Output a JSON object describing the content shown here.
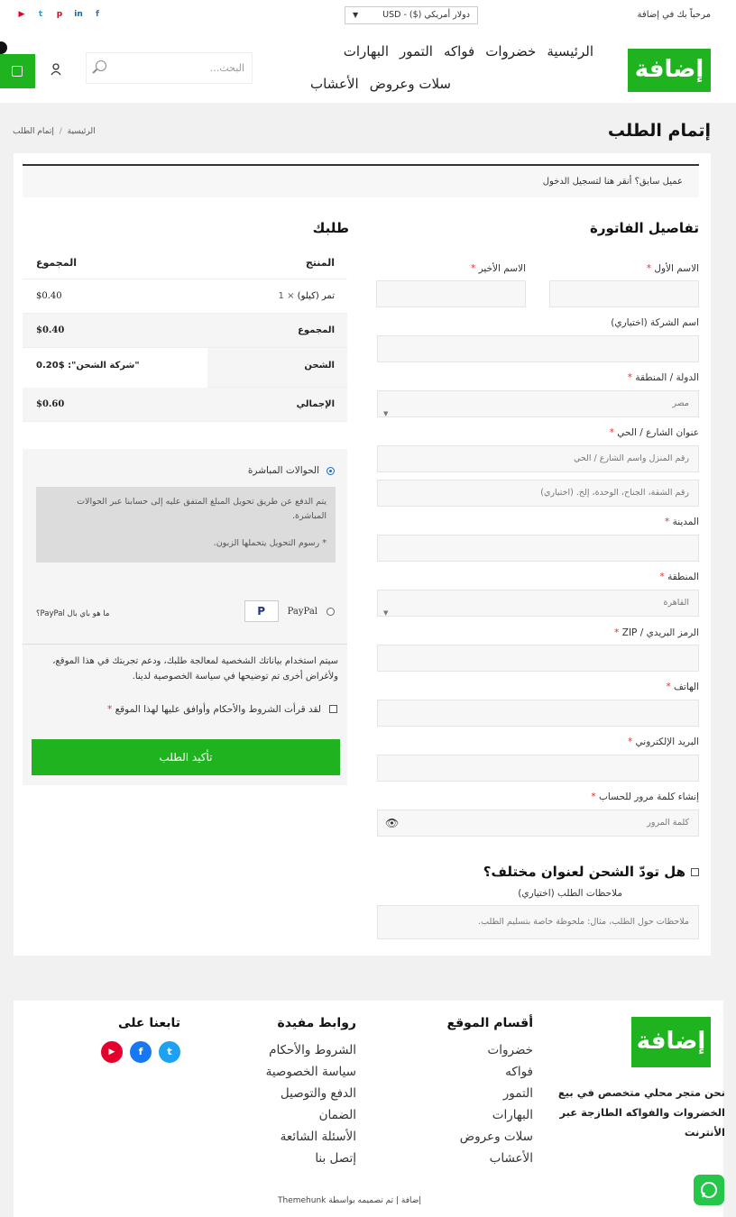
{
  "topbar": {
    "welcome": "مرحباً بك في إضافة",
    "currency": "دولار أمريكي ($) - USD",
    "currency_arrow": "▼",
    "social": [
      {
        "icon": "youtube-icon",
        "glyph": "▶",
        "color": "#e4002b"
      },
      {
        "icon": "twitter-icon",
        "glyph": "t",
        "color": "#1da1f2"
      },
      {
        "icon": "pinterest-icon",
        "glyph": "p",
        "color": "#e60023"
      },
      {
        "icon": "linkedin-icon",
        "glyph": "in",
        "color": "#0a66c2"
      },
      {
        "icon": "facebook-icon",
        "glyph": "f",
        "color": "#1877f2"
      }
    ]
  },
  "header": {
    "logo": "إضافة",
    "nav_row1": [
      "الرئيسية",
      "خضروات",
      "فواكه",
      "التمور",
      "البهارات"
    ],
    "nav_row2": [
      "سلات وعروض",
      "الأعشاب"
    ],
    "search_placeholder": "البحث..."
  },
  "page": {
    "title": "إتمام الطلب",
    "breadcrumb_home": "الرئيسية",
    "breadcrumb_sep": "/",
    "breadcrumb_current": "إتمام الطلب"
  },
  "login_notice": "عميل سابق؟ أنقر هنا لتسجيل الدخول",
  "billing": {
    "heading": "تفاصيل الفاتورة",
    "first_name_label": "الاسم الأول",
    "last_name_label": "الاسم الأخير",
    "company_label": "اسم الشركة (اختياري)",
    "country_label": "الدولة / المنطقة",
    "country_value": "مصر",
    "street_label": "عنوان الشارع / الحي",
    "street_placeholder": "رقم المنزل واسم الشارع / الحي",
    "street2_placeholder": "رقم الشقة، الجناح، الوحدة، إلخ. (اختياري)",
    "city_label": "المدينة",
    "state_label": "المنطقة",
    "state_value": "القاهرة",
    "zip_label": "الرمز البريدي / ZIP",
    "phone_label": "الهاتف",
    "email_label": "البريد الإلكتروني",
    "password_label": "إنشاء كلمة مرور للحساب",
    "password_placeholder": "كلمة المرور",
    "required_mark": "*"
  },
  "shipping": {
    "ship_different": "هل تودّ الشحن لعنوان مختلف؟",
    "notes_label": "ملاحظات الطلب (اختياري)",
    "notes_placeholder": "ملاحظات حول الطلب، مثال: ملحوظة خاصة بتسليم الطلب."
  },
  "order": {
    "heading": "طلبك",
    "col_product": "المنتج",
    "col_total": "المجموع",
    "item_name": "تمر (كيلو)",
    "item_qty": "× 1",
    "item_total": "$0.40",
    "subtotal_label": "المجموع",
    "subtotal_value": "$0.40",
    "shipping_label": "الشحن",
    "shipping_value": "\"شركة الشحن\": $0.20",
    "total_label": "الإجمالي",
    "total_value": "$0.60"
  },
  "payment": {
    "bank_label": "الحوالات المباشرة",
    "bank_desc1": "يتم الدفع عن طريق تحويل المبلغ المتفق عليه إلى حسابنا عبر الحوالات المباشرة.",
    "bank_desc2": "* رسوم التحويل يتحملها الزبون.",
    "paypal_label": "PayPal",
    "paypal_badge": "P",
    "paypal_what": "ما هو باي بال PayPal؟",
    "privacy_text": "سيتم استخدام بياناتك الشخصية لمعالجة طلبك، ودعم تجربتك في هذا الموقع، ولأغراض أخرى تم توضيحها في سياسة الخصوصية لدينا.",
    "terms_text": "لقد قرأت الشروط والأحكام وأوافق عليها لهذا الموقع",
    "place_order": "تأكيد الطلب"
  },
  "footer": {
    "logo": "إضافة",
    "description": "نحن متجر محلي متخصص في بيع الخضروات والفواكه الطازجة عبر الأنترنت",
    "sections_heading": "أقسام الموقع",
    "sections": [
      "خضروات",
      "فواكه",
      "التمور",
      "البهارات",
      "سلات وعروض",
      "الأعشاب"
    ],
    "useful_heading": "روابط مفيدة",
    "useful": [
      "الشروط والأحكام",
      "سياسة الخصوصية",
      "الدفع والتوصيل",
      "الضمان",
      "الأسئلة الشائعة",
      "إتصل بنا"
    ],
    "follow_heading": "تابعنا على",
    "follow": [
      {
        "icon": "twitter-icon",
        "glyph": "t",
        "color": "#1da1f2"
      },
      {
        "icon": "facebook-icon",
        "glyph": "f",
        "color": "#1877f2"
      },
      {
        "icon": "youtube-icon",
        "glyph": "▶",
        "color": "#e4002b"
      }
    ],
    "copyright": "إضافة | تم تصميمه بواسطة Themehunk"
  }
}
